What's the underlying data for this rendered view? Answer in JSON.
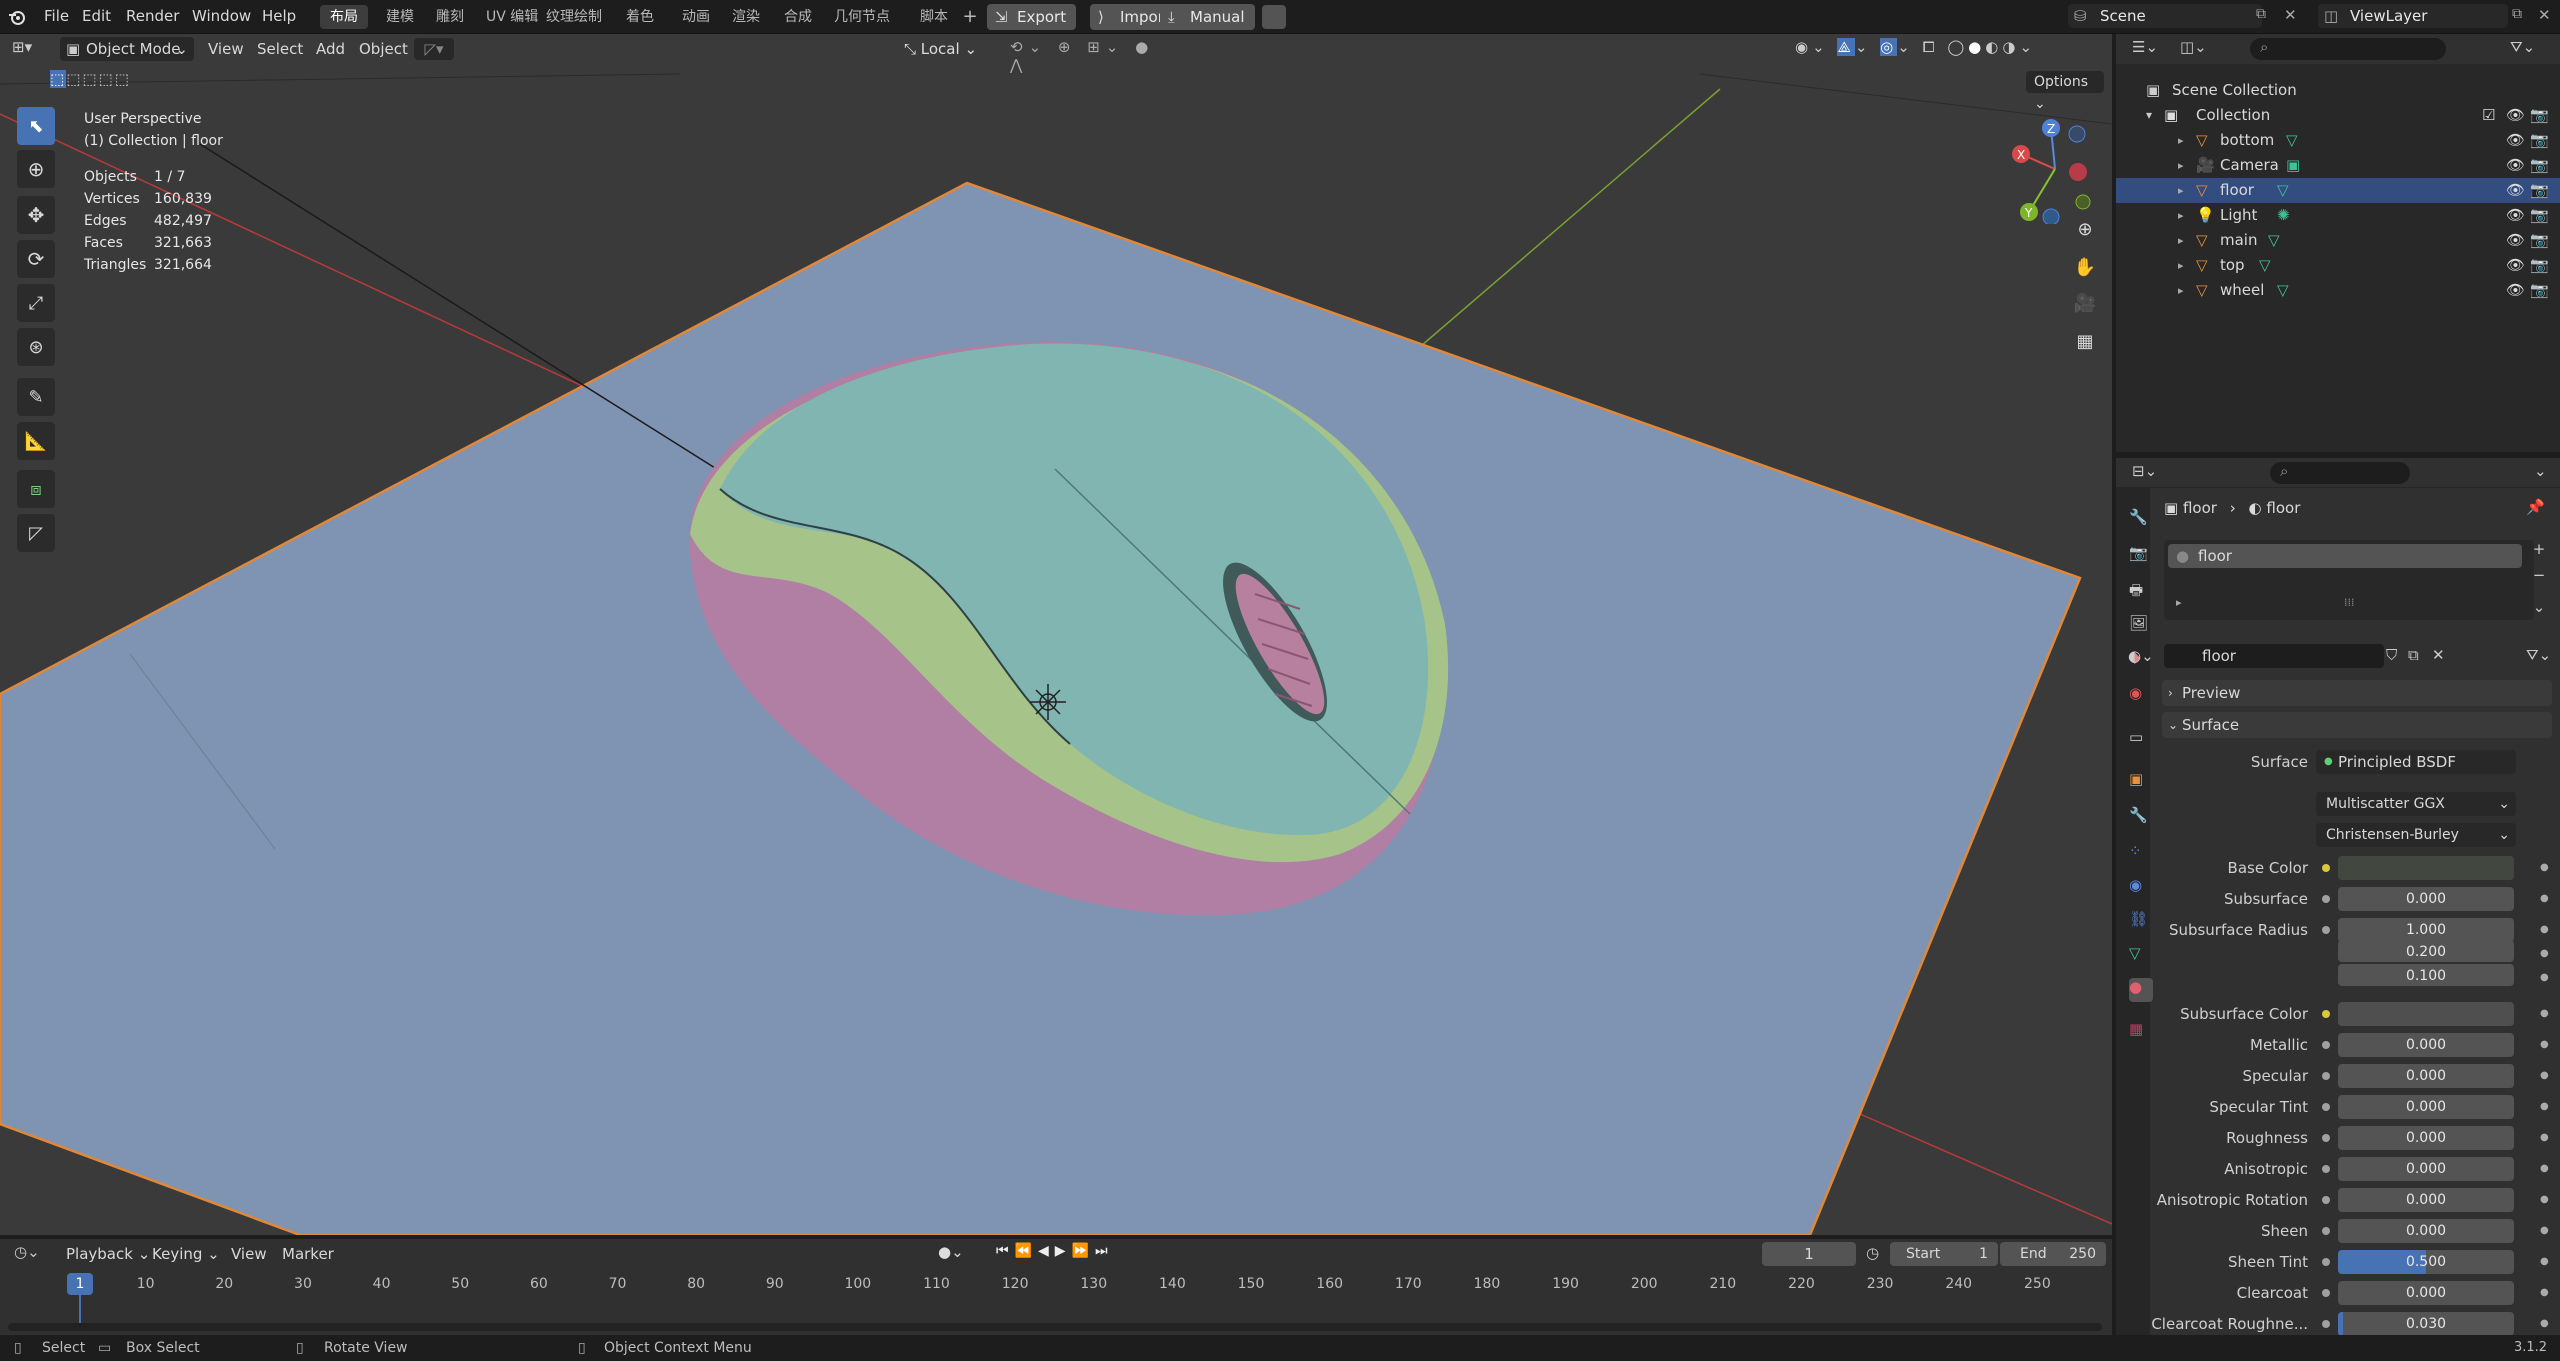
{
  "menu": {
    "file": "File",
    "edit": "Edit",
    "render": "Render",
    "window": "Window",
    "help": "Help"
  },
  "workspaces": [
    "布局",
    "建模",
    "雕刻",
    "UV 编辑",
    "纹理绘制",
    "着色",
    "动画",
    "渲染",
    "合成",
    "几何节点",
    "脚本"
  ],
  "toolbar_top": {
    "export": "Export",
    "import": "Import",
    "manual": "Manual",
    "scene": "Scene",
    "view_layer": "ViewLayer"
  },
  "viewport_header": {
    "mode": "Object Mode",
    "view": "View",
    "select": "Select",
    "add": "Add",
    "object": "Object",
    "orientation": "Local",
    "options": "Options"
  },
  "overlay": {
    "perspective": "User Perspective",
    "context": "(1) Collection | floor",
    "stats": [
      {
        "k": "Objects",
        "v": "1 / 7"
      },
      {
        "k": "Vertices",
        "v": "160,839"
      },
      {
        "k": "Edges",
        "v": "482,497"
      },
      {
        "k": "Faces",
        "v": "321,663"
      },
      {
        "k": "Triangles",
        "v": "321,664"
      }
    ]
  },
  "gizmo": {
    "x": "X",
    "y": "Y",
    "z": "Z"
  },
  "outliner": {
    "root": "Scene Collection",
    "collection": "Collection",
    "items": [
      {
        "name": "bottom",
        "icon": "mesh-icon"
      },
      {
        "name": "Camera",
        "icon": "camera-icon"
      },
      {
        "name": "floor",
        "icon": "mesh-icon"
      },
      {
        "name": "Light",
        "icon": "light-icon"
      },
      {
        "name": "main",
        "icon": "mesh-icon"
      },
      {
        "name": "top",
        "icon": "mesh-icon"
      },
      {
        "name": "wheel",
        "icon": "mesh-icon"
      }
    ]
  },
  "properties": {
    "breadcrumb_object": "floor",
    "breadcrumb_material": "floor",
    "slot": "floor",
    "material_name": "floor",
    "preview": "Preview",
    "surface_panel": "Surface",
    "surface_label": "Surface",
    "surface_value": "Principled BSDF",
    "distribution": "Multiscatter GGX",
    "sss_method": "Christensen-Burley",
    "rows": [
      {
        "label": "Base Color",
        "value": "",
        "type": "color",
        "color": "#42483f"
      },
      {
        "label": "Subsurface",
        "value": "0.000",
        "type": "num"
      },
      {
        "label": "Subsurface Radius",
        "value": "1.000",
        "type": "num"
      },
      {
        "label": "",
        "value": "0.200",
        "type": "num"
      },
      {
        "label": "",
        "value": "0.100",
        "type": "num"
      },
      {
        "label": "Subsurface Color",
        "value": "",
        "type": "color",
        "color": "#4f4f4f"
      },
      {
        "label": "Metallic",
        "value": "0.000",
        "type": "num"
      },
      {
        "label": "Specular",
        "value": "0.000",
        "type": "num"
      },
      {
        "label": "Specular Tint",
        "value": "0.000",
        "type": "num"
      },
      {
        "label": "Roughness",
        "value": "0.000",
        "type": "num"
      },
      {
        "label": "Anisotropic",
        "value": "0.000",
        "type": "num"
      },
      {
        "label": "Anisotropic Rotation",
        "value": "0.000",
        "type": "num"
      },
      {
        "label": "Sheen",
        "value": "0.000",
        "type": "num"
      },
      {
        "label": "Sheen Tint",
        "value": "0.500",
        "type": "num",
        "fill": 0.5
      },
      {
        "label": "Clearcoat",
        "value": "0.000",
        "type": "num"
      },
      {
        "label": "Clearcoat Roughne...",
        "value": "0.030",
        "type": "num",
        "fill": 0.03
      }
    ]
  },
  "timeline": {
    "playback": "Playback",
    "keying": "Keying",
    "view": "View",
    "marker": "Marker",
    "current": "1",
    "start_label": "Start",
    "start": "1",
    "end_label": "End",
    "end": "250",
    "ticks": [
      "1",
      "10",
      "20",
      "30",
      "40",
      "50",
      "60",
      "70",
      "80",
      "90",
      "100",
      "110",
      "120",
      "130",
      "140",
      "150",
      "160",
      "170",
      "180",
      "190",
      "200",
      "210",
      "220",
      "230",
      "240",
      "250"
    ]
  },
  "status": {
    "select": "Select",
    "box_select": "Box Select",
    "rotate": "Rotate View",
    "context_menu": "Object Context Menu",
    "version": "3.1.2"
  },
  "colors": {
    "accent": "#4772b3",
    "selected_row": "#334d80",
    "floor": "#7f93b3",
    "mouse_top": "#7fb4b0",
    "mouse_side": "#a8c48a",
    "mouse_bottom": "#b27fa4",
    "outline": "#e0883a"
  }
}
